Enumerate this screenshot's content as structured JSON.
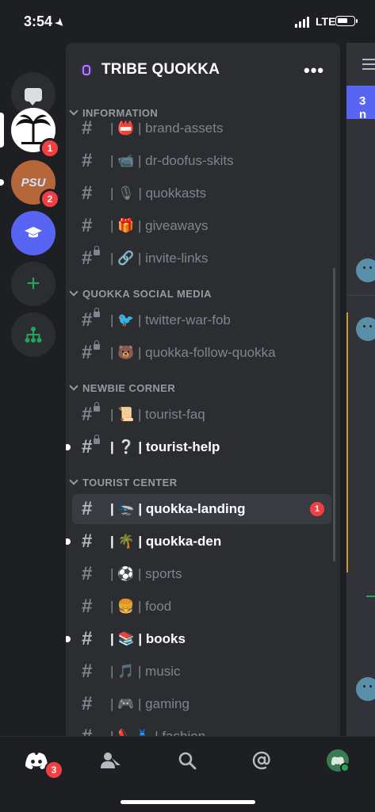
{
  "status_bar": {
    "time": "3:54",
    "network": "LTE"
  },
  "rail": {
    "servers": [
      {
        "name": "direct-messages",
        "icon": "chat-bubble-icon"
      },
      {
        "name": "tribe-quokka",
        "badge": "1"
      },
      {
        "name": "psu",
        "label": "PSU",
        "badge": "2"
      },
      {
        "name": "education",
        "icon": "graduation-cap-icon"
      },
      {
        "name": "add-server",
        "icon": "plus-icon"
      },
      {
        "name": "discover",
        "icon": "hierarchy-icon"
      }
    ]
  },
  "server": {
    "name": "TRIBE QUOKKA",
    "more": "•••"
  },
  "categories": {
    "information": "INFORMATION",
    "social": "QUOKKA SOCIAL MEDIA",
    "newbie": "NEWBIE CORNER",
    "tourist": "TOURIST CENTER"
  },
  "channels": [
    {
      "label": "| 📛 | brand-assets"
    },
    {
      "label": "| 📹 | dr-doofus-skits"
    },
    {
      "label": "| 🎙 | quokkasts"
    },
    {
      "label": "| 🎁 | giveaways"
    },
    {
      "label": "| 🔗 | invite-links"
    },
    {
      "label": "| 🐦 | twitter-war-fob"
    },
    {
      "label": "| 🐻 | quokka-follow-quokka"
    },
    {
      "label": "| 📜 | tourist-faq"
    },
    {
      "label": "| ❔ | tourist-help"
    },
    {
      "label": "| 🛬 | quokka-landing",
      "badge": "1"
    },
    {
      "label": "| 🌴 | quokka-den"
    },
    {
      "label": "| ⚽ | sports"
    },
    {
      "label": "| 🍔 | food"
    },
    {
      "label": "| 📚 | books"
    },
    {
      "label": "| 🎵 | music"
    },
    {
      "label": "| 🎮 | gaming"
    },
    {
      "label": "| 👠👗 | fashion"
    }
  ],
  "peek": {
    "banner": "3 n"
  },
  "tabbar": {
    "home_badge": "3"
  },
  "colors": {
    "accent": "#5865f2",
    "danger": "#f23f43",
    "online": "#23a55a",
    "panel": "#2b2d31"
  }
}
